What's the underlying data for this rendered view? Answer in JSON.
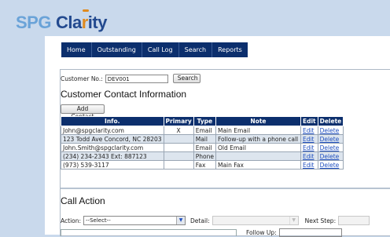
{
  "logo": {
    "spg": "SPG",
    "cla": "Cla",
    "r": "r",
    "ity": "ity"
  },
  "nav": [
    "Home",
    "Outstanding",
    "Call Log",
    "Search",
    "Reports"
  ],
  "customer": {
    "label": "Customer No.:",
    "value": "DEV001",
    "search_label": "Search"
  },
  "contact_section": {
    "title": "Customer Contact Information",
    "add_label": "Add Contact",
    "headers": [
      "Info.",
      "Primary",
      "Type",
      "Note",
      "Edit",
      "Delete"
    ],
    "rows": [
      {
        "info": "John@spgclarity.com",
        "primary": "X",
        "type": "Email",
        "note": "Main Email",
        "edit": "Edit",
        "delete": "Delete"
      },
      {
        "info": "123 Todd Ave Concord, NC 28203",
        "primary": "",
        "type": "Mail",
        "note": "Follow-up with a phone call",
        "edit": "Edit",
        "delete": "Delete"
      },
      {
        "info": "John.Smith@spgclarity.com",
        "primary": "",
        "type": "Email",
        "note": "Old Email",
        "edit": "Edit",
        "delete": "Delete"
      },
      {
        "info": "(234) 234-2343 Ext: 887123",
        "primary": "",
        "type": "Phone",
        "note": "",
        "edit": "Edit",
        "delete": "Delete"
      },
      {
        "info": "(973) 539-3117",
        "primary": "",
        "type": "Fax",
        "note": "Main Fax",
        "edit": "Edit",
        "delete": "Delete"
      }
    ]
  },
  "call_action": {
    "title": "Call Action",
    "action_label": "Action:",
    "action_value": "--Select--",
    "detail_label": "Detail:",
    "next_step_label": "Next Step:",
    "follow_up_label": "Follow Up:"
  },
  "colors": {
    "nav_bg": "#0c2f6d",
    "page_bg": "#c9d9ec",
    "accent": "#e08a1e"
  }
}
